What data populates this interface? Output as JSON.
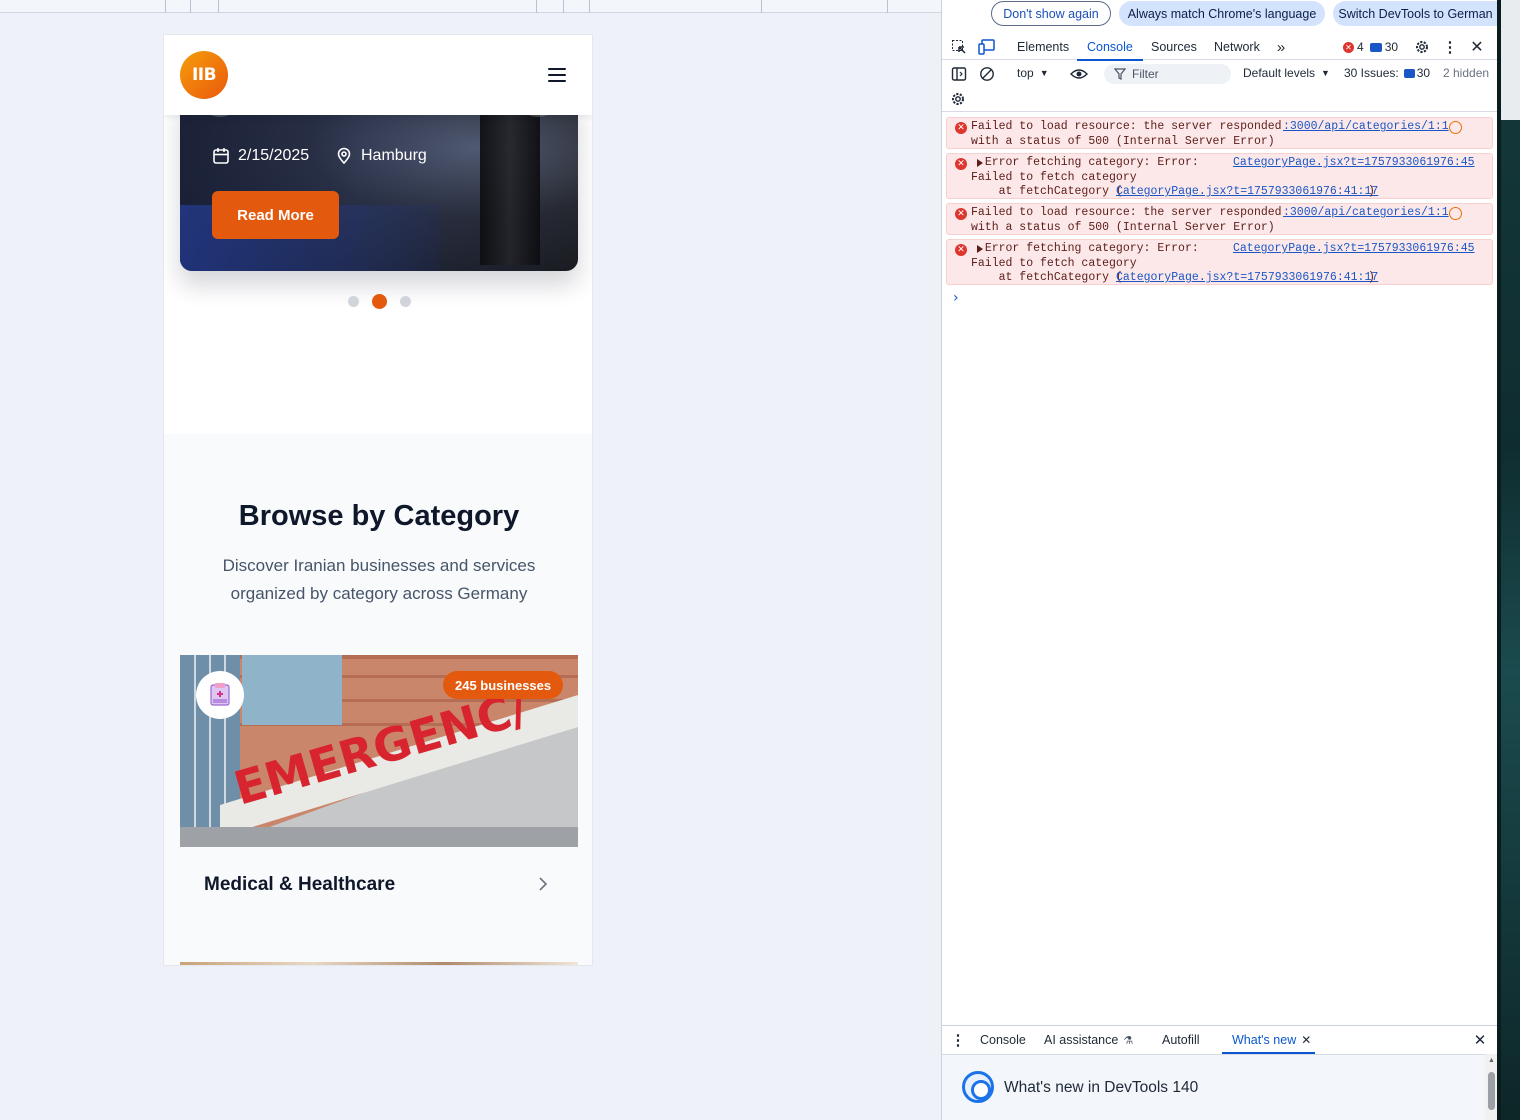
{
  "site": {
    "logo_text": "IIB",
    "hero": {
      "date": "2/15/2025",
      "location": "Hamburg",
      "cta": "Read More"
    },
    "carousel": {
      "slides": 3,
      "active_index": 1
    },
    "categories": {
      "title": "Browse by Category",
      "subtitle": "Discover Iranian businesses and services organized by category across Germany",
      "items": [
        {
          "name": "Medical & Healthcare",
          "badge": "245 businesses",
          "image_text": "EMERGENCY"
        }
      ]
    }
  },
  "devtools": {
    "infobar": {
      "dont_show": "Don't show again",
      "match_language": "Always match Chrome's language",
      "switch_language": "Switch DevTools to German"
    },
    "tabs": [
      "Elements",
      "Console",
      "Sources",
      "Network"
    ],
    "active_tab": "Console",
    "error_count": "4",
    "issue_count": "30",
    "toolbar": {
      "context": "top",
      "filter_placeholder": "Filter",
      "levels": "Default levels",
      "issues_label": "30 Issues:",
      "issues_count": "30",
      "hidden": "2 hidden"
    },
    "messages": [
      {
        "line1": "Failed to load resource: the server responded",
        "line2": "with a status of 500 (Internal Server Error)",
        "source": ":3000/api/categories/1:1"
      },
      {
        "line1": "Error fetching category: Error:",
        "line2": "Failed to fetch category",
        "line3_prefix": "    at fetchCategory (",
        "line3_link": "CategoryPage.jsx?t=1757933061976:41:17",
        "line3_suffix": ")",
        "source": "CategoryPage.jsx?t=1757933061976:45"
      },
      {
        "line1": "Failed to load resource: the server responded",
        "line2": "with a status of 500 (Internal Server Error)",
        "source": ":3000/api/categories/1:1"
      },
      {
        "line1": "Error fetching category: Error:",
        "line2": "Failed to fetch category",
        "line3_prefix": "    at fetchCategory (",
        "line3_link": "CategoryPage.jsx?t=1757933061976:41:17",
        "line3_suffix": ")",
        "source": "CategoryPage.jsx?t=1757933061976:45"
      }
    ],
    "drawer": {
      "tabs": [
        "Console",
        "AI assistance",
        "Autofill",
        "What's new"
      ],
      "active_tab": "What's new",
      "whats_new_title": "What's new in DevTools 140"
    },
    "colors": {
      "accent": "#0b57d0",
      "error_bg": "#fce8e8",
      "brand_orange": "#e35a0f"
    }
  }
}
